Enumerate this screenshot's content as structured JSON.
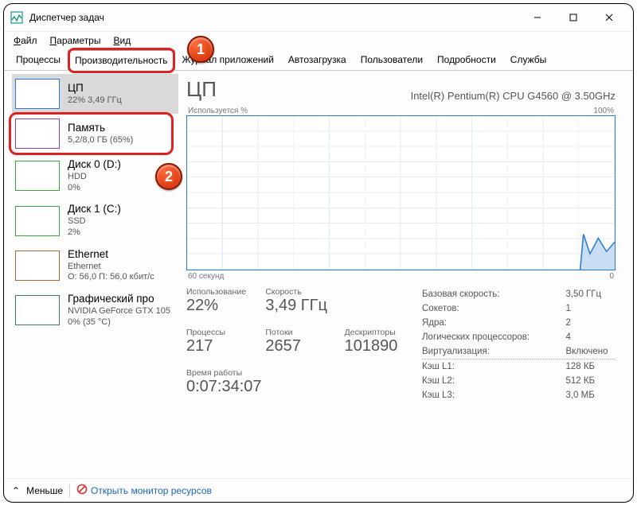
{
  "window": {
    "title": "Диспетчер задач"
  },
  "menu": {
    "file": "Файл",
    "options": "Параметры",
    "view": "Вид"
  },
  "tabs": {
    "processes": "Процессы",
    "performance": "Производительность",
    "app_history": "Журнал приложений",
    "startup": "Автозагрузка",
    "users": "Пользователи",
    "details": "Подробности",
    "services": "Службы"
  },
  "side": {
    "cpu": {
      "title": "ЦП",
      "sub": "22% 3,49 ГГц"
    },
    "mem": {
      "title": "Память",
      "sub": "5,2/8,0 ГБ (65%)"
    },
    "disk0": {
      "title": "Диск 0 (D:)",
      "sub1": "HDD",
      "sub2": "0%"
    },
    "disk1": {
      "title": "Диск 1 (C:)",
      "sub1": "SSD",
      "sub2": "2%"
    },
    "eth": {
      "title": "Ethernet",
      "sub1": "Ethernet",
      "sub2": "О: 56,0 П: 56,0 кбит/с"
    },
    "gpu": {
      "title": "Графический про",
      "sub1": "NVIDIA GeForce GTX 105",
      "sub2": "0% (35 °C)"
    }
  },
  "panel": {
    "title": "ЦП",
    "model": "Intel(R) Pentium(R) CPU G4560 @ 3.50GHz",
    "chart_top_left": "Используется %",
    "chart_top_right": "100%",
    "chart_bottom_left": "60 секунд",
    "chart_bottom_right": "0"
  },
  "stats": {
    "usage_lbl": "Использование",
    "usage_val": "22%",
    "speed_lbl": "Скорость",
    "speed_val": "3,49 ГГц",
    "proc_lbl": "Процессы",
    "proc_val": "217",
    "thr_lbl": "Потоки",
    "thr_val": "2657",
    "hnd_lbl": "Дескрипторы",
    "hnd_val": "101890",
    "uptime_lbl": "Время работы",
    "uptime_val": "0:07:34:07"
  },
  "right": {
    "base_lbl": "Базовая скорость:",
    "base_val": "3,50 ГГц",
    "sock_lbl": "Сокетов:",
    "sock_val": "1",
    "core_lbl": "Ядра:",
    "core_val": "2",
    "lproc_lbl": "Логических процессоров:",
    "lproc_val": "4",
    "virt_lbl": "Виртуализация:",
    "virt_val": "Включено",
    "l1_lbl": "Кэш L1:",
    "l1_val": "128 КБ",
    "l2_lbl": "Кэш L2:",
    "l2_val": "512 КБ",
    "l3_lbl": "Кэш L3:",
    "l3_val": "3,0 МБ"
  },
  "footer": {
    "fewer": "Меньше",
    "open_rm": "Открыть монитор ресурсов"
  },
  "badges": {
    "one": "1",
    "two": "2"
  },
  "colors": {
    "cpu": "#2a7bd6",
    "mem": "#8e3fbf",
    "disk": "#3aa53a",
    "eth": "#9a6a2f",
    "gpu": "#3a7a6a"
  }
}
